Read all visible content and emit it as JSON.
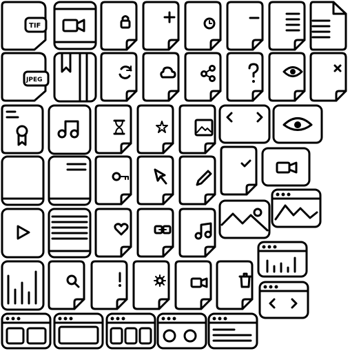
{
  "sheet": {
    "title": "",
    "background": "#ffffff",
    "stroke_color": "#000000"
  },
  "badges": {
    "tif": "TIF",
    "jpeg": "JPEG"
  },
  "rows": [
    [
      "file-tif-icon",
      "film-video-icon",
      "file-lock-icon",
      "file-add-icon",
      "file-clock-icon",
      "file-remove-icon",
      "document-text-icon",
      "document-lines-icon"
    ],
    [
      "file-jpeg-icon",
      "notebook-bookmark-icon",
      "file-sync-icon",
      "file-cloud-icon",
      "file-share-icon",
      "file-help-icon",
      "file-view-icon",
      "file-delete-icon"
    ],
    [
      "file-ribbon-icon",
      "music-card-icon",
      "file-hourglass-icon",
      "file-star-icon",
      "file-image-icon",
      "code-window-icon",
      "eye-window-icon"
    ],
    [
      "blank-card-icon",
      "document-header-icon",
      "file-key-icon",
      "file-cursor-icon",
      "file-edit-icon",
      "file-check-icon",
      "video-card-icon"
    ],
    [
      "play-card-icon",
      "lines-card-icon",
      "file-heart-icon",
      "file-link-icon",
      "file-music-icon",
      "image-card-icon",
      "browser-chart-icon"
    ],
    [
      "bar-chart-card-icon",
      "file-search-icon",
      "file-alert-icon",
      "file-settings-icon",
      "file-video-icon",
      "file-trash-icon",
      "browser-bars-icon",
      "browser-code-icon"
    ],
    [
      "browser-panels-icon",
      "browser-frame-icon",
      "browser-columns-icon",
      "browser-media-icon",
      "browser-text-icon"
    ]
  ]
}
